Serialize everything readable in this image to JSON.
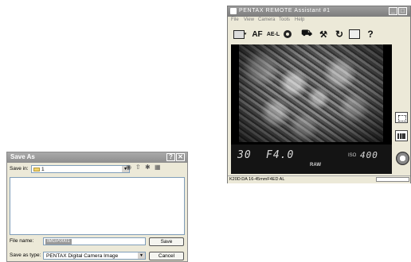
{
  "save_dialog": {
    "title": "Save As",
    "help_glyph": "?",
    "close_glyph": "✕",
    "save_in_label": "Save in:",
    "save_in_value": "1",
    "nav_icons": [
      "back-icon",
      "up-folder-icon",
      "new-folder-icon",
      "view-menu-icon"
    ],
    "file_name_label": "File name:",
    "file_name_value": "IMGP0001",
    "save_as_type_label": "Save as type:",
    "save_as_type_value": "PENTAX Digital Camera Image",
    "save_button": "Save",
    "cancel_button": "Cancel"
  },
  "pentax_window": {
    "title": "PENTAX REMOTE Assistant #1",
    "menu": [
      "File",
      "View",
      "Camera",
      "Tools",
      "Help"
    ],
    "toolbar": {
      "af_label": "AF",
      "ael_label": "AE-L",
      "help_glyph": "?"
    },
    "live_view": {
      "shutter_speed": "30",
      "aperture": "F4.0",
      "quality": "RAW",
      "iso_label": "ISO",
      "iso_value": "400"
    },
    "status_text": "K20D:DA 16-45mmF4ED AL"
  },
  "colors": {
    "dialog_bg": "#ece9d8",
    "titlebar": "#8e8e8e",
    "field_border": "#7f9db9",
    "lcd_text": "#d8d8d8"
  }
}
